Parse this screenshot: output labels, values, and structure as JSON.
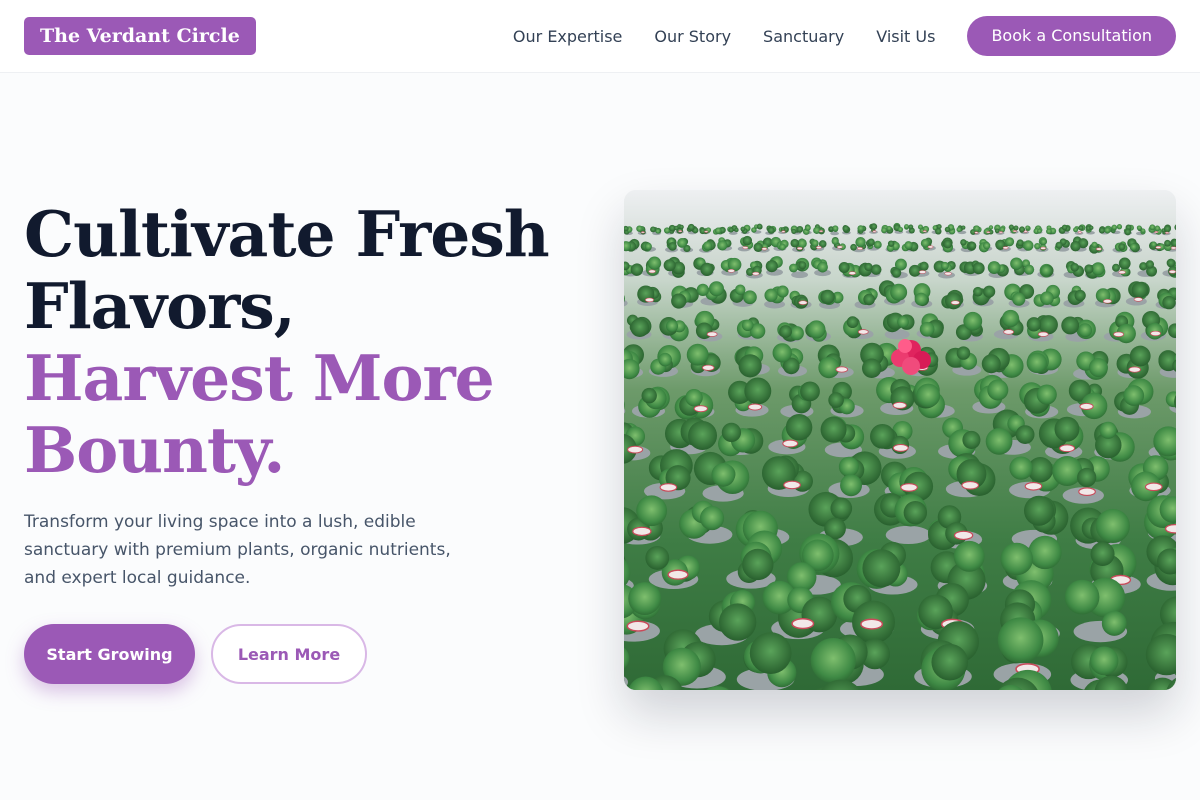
{
  "header": {
    "logo": "The Verdant Circle",
    "nav": [
      "Our Expertise",
      "Our Story",
      "Sanctuary",
      "Visit Us"
    ],
    "cta": "Book a Consultation"
  },
  "hero": {
    "title_lines": [
      "Cultivate Fresh",
      "Flavors,"
    ],
    "title_accent_lines": [
      "Harvest More",
      "Bounty."
    ],
    "description": "Transform your living space into a lush, edible sanctuary with premium plants, organic nutrients, and expert local guidance.",
    "primary_button": "Start Growing",
    "secondary_button": "Learn More",
    "image_icon": "greenhouse-potted-plants-photo"
  },
  "colors": {
    "accent": "#9b59b6",
    "heading": "#111a2e",
    "body_text": "#475569",
    "background": "#fbfcfd"
  }
}
